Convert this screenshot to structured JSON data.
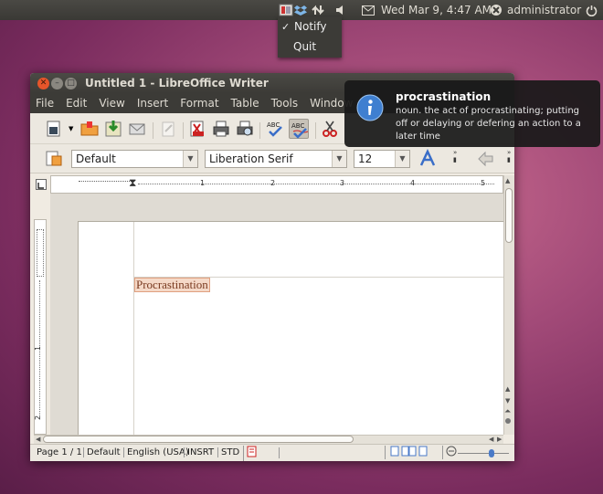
{
  "top_panel": {
    "datetime": "Wed Mar  9,  4:47 AM",
    "user": "administrator"
  },
  "tray_menu": {
    "items": [
      {
        "label": "Notify",
        "checked": true
      },
      {
        "label": "Quit",
        "checked": false
      }
    ]
  },
  "window": {
    "title": "Untitled 1 - LibreOffice Writer",
    "menus": [
      "File",
      "Edit",
      "View",
      "Insert",
      "Format",
      "Table",
      "Tools",
      "Window"
    ]
  },
  "formatting": {
    "paragraph_style": "Default",
    "font_name": "Liberation Serif",
    "font_size": "12"
  },
  "ruler": {
    "h_marks": [
      "1",
      "2",
      "3",
      "4",
      "5"
    ],
    "v_marks": [
      "1",
      "2"
    ]
  },
  "document": {
    "text": "Procrastination"
  },
  "status_bar": {
    "page": "Page 1 / 1",
    "style": "Default",
    "language": "English (USA)",
    "mode": "INSRT",
    "selection": "STD"
  },
  "notification": {
    "title": "procrastination",
    "body": "noun. the act of procrastinating; putting off or delaying or defering an action to a later time"
  },
  "colors": {
    "panel": "#3c3b37",
    "close_button": "#e6552a",
    "wallpaper": "#a24a78",
    "text_highlight": "#f5d9c8"
  }
}
